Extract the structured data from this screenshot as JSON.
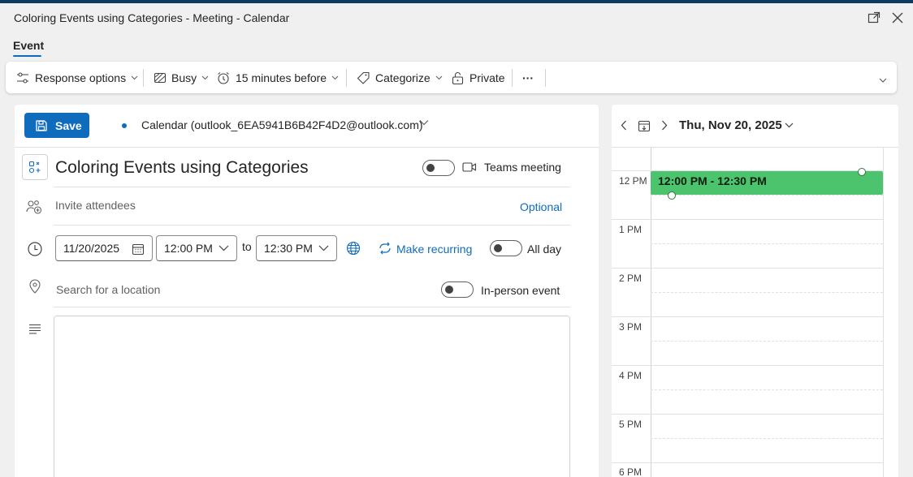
{
  "window": {
    "title": "Coloring Events using Categories - Meeting - Calendar"
  },
  "tabs": [
    {
      "label": "Event",
      "active": true
    }
  ],
  "ribbon": {
    "response_options": "Response options",
    "busy": "Busy",
    "reminder": "15 minutes before",
    "categorize": "Categorize",
    "private": "Private",
    "more": "···"
  },
  "form": {
    "save_label": "Save",
    "calendar": "Calendar (outlook_6EA5941B6B42F4D2@outlook.com)",
    "subject": "Coloring Events using Categories",
    "teams_meeting_label": "Teams meeting",
    "teams_meeting_on": false,
    "attendees_placeholder": "Invite attendees",
    "optional_link": "Optional",
    "start_date": "11/20/2025",
    "start_time": "12:00 PM",
    "to_label": "to",
    "end_time": "12:30 PM",
    "make_recurring": "Make recurring",
    "all_day_label": "All day",
    "all_day_on": false,
    "location_placeholder": "Search for a location",
    "in_person_label": "In-person event",
    "in_person_on": false,
    "body": ""
  },
  "day_view": {
    "date_header": "Thu, Nov 20, 2025",
    "hours": [
      "12 PM",
      "1 PM",
      "2 PM",
      "3 PM",
      "4 PM",
      "5 PM",
      "6 PM"
    ],
    "event": {
      "time_range": "12:00 PM - 12:30 PM",
      "color": "#4cc46e"
    }
  },
  "colors": {
    "accent": "#0f6cbd",
    "event_green": "#4cc46e"
  }
}
